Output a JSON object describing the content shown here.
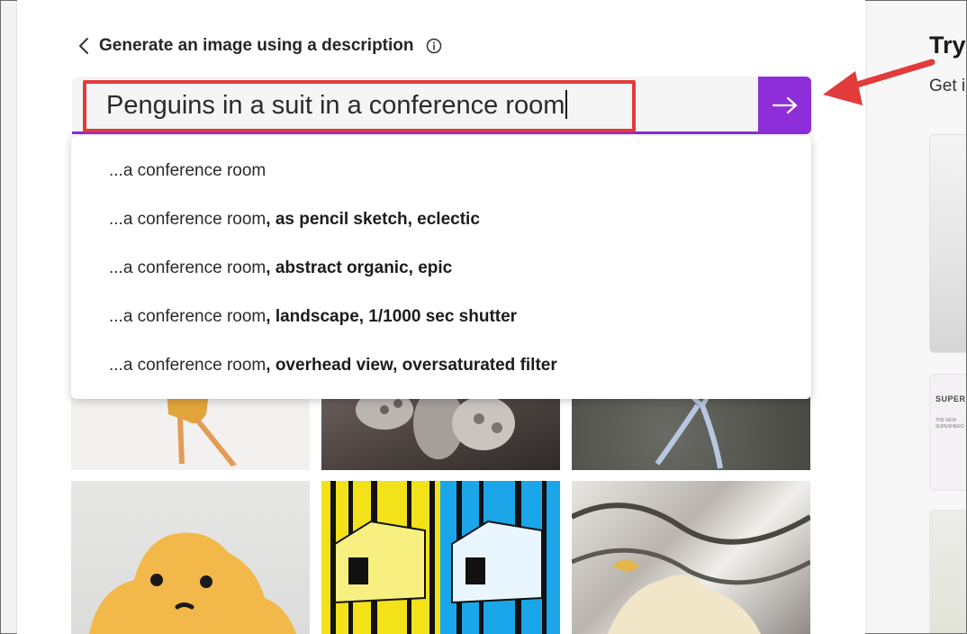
{
  "header": {
    "title": "Generate an image using a description",
    "back_icon": "chevron-left-icon",
    "info_icon": "info-icon"
  },
  "prompt": {
    "value": "Penguins in a suit in a conference room",
    "submit_icon": "arrow-right-icon",
    "accent_color": "#8d2ed8",
    "highlight_color": "#e23b3b"
  },
  "suggestions": [
    {
      "prefix": "...a conference room",
      "bold": ""
    },
    {
      "prefix": "...a conference room",
      "bold": ", as pencil sketch, eclectic"
    },
    {
      "prefix": "...a conference room",
      "bold": ", abstract organic, epic"
    },
    {
      "prefix": "...a conference room",
      "bold": ", landscape, 1/1000 sec shutter"
    },
    {
      "prefix": "...a conference room",
      "bold": ", overhead view, oversaturated filter"
    }
  ],
  "right_panel": {
    "title": "Try",
    "subtitle": "Get i",
    "card_heading": "SUPER",
    "card_subtext_1": "THE NEW",
    "card_subtext_2": "SUPERHERO"
  },
  "annotation": {
    "arrow_color": "#e23b3b"
  }
}
